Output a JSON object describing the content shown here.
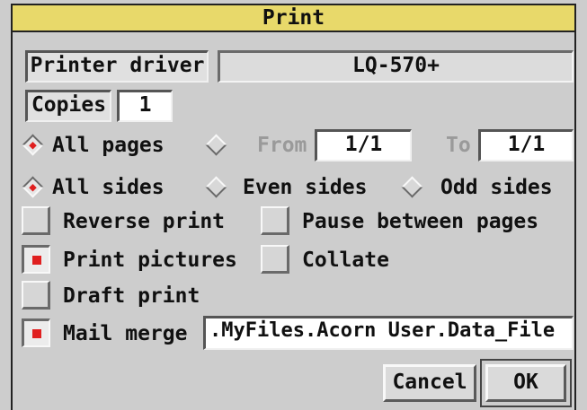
{
  "window": {
    "title": "Print"
  },
  "printer_driver": {
    "label": "Printer driver",
    "value": "LQ-570+"
  },
  "copies": {
    "label": "Copies",
    "value": "1"
  },
  "pages": {
    "all_label": "All pages",
    "all_selected": true,
    "from_label": "From",
    "from_value": "1/1",
    "to_label": "To",
    "to_value": "1/1",
    "range_selected": false
  },
  "sides": {
    "all_label": "All sides",
    "even_label": "Even sides",
    "odd_label": "Odd sides",
    "selected": "all"
  },
  "options": {
    "reverse_print": {
      "label": "Reverse print",
      "checked": false
    },
    "pause_between_pages": {
      "label": "Pause between pages",
      "checked": false
    },
    "print_pictures": {
      "label": "Print pictures",
      "checked": true
    },
    "collate": {
      "label": "Collate",
      "checked": false
    },
    "draft_print": {
      "label": "Draft print",
      "checked": false
    },
    "mail_merge": {
      "label": "Mail merge",
      "checked": true,
      "path": ".MyFiles.Acorn User.Data_File"
    }
  },
  "buttons": {
    "cancel": "Cancel",
    "ok": "OK"
  },
  "colors": {
    "title_bar": "#e8d96a",
    "window_bg": "#cdcdcd",
    "selection_indicator": "#e02020"
  }
}
